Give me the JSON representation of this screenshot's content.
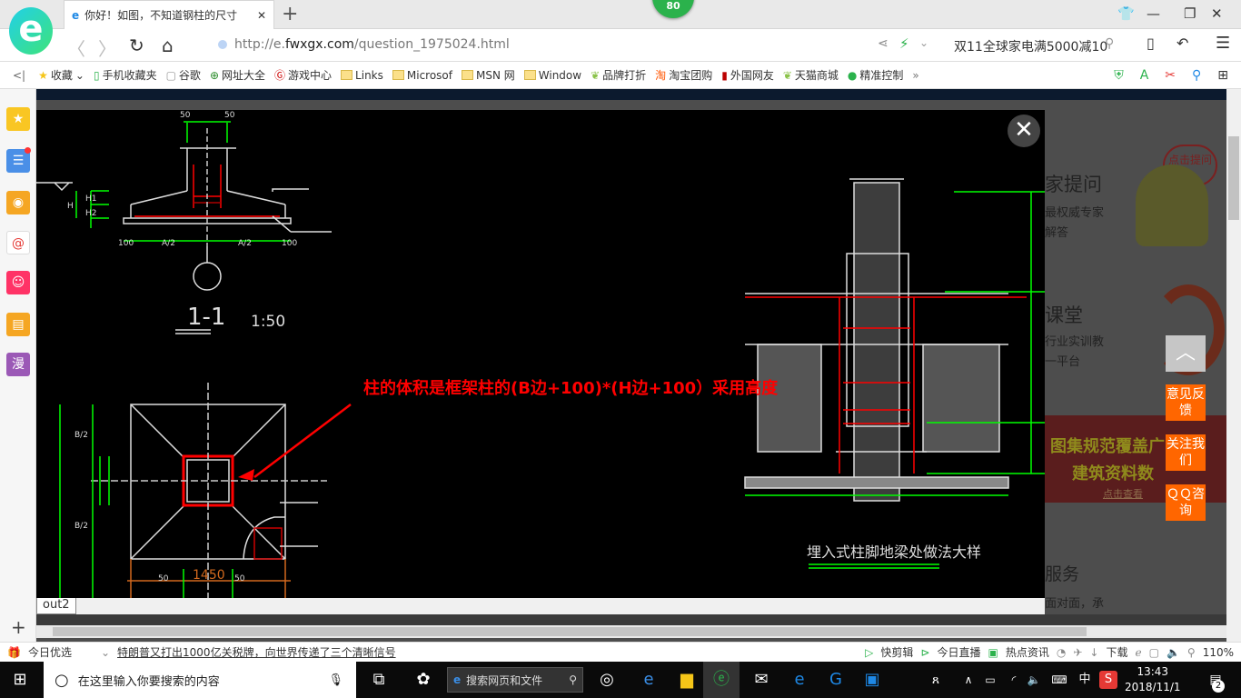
{
  "browser": {
    "tab_title": "你好！如图，不知道钢柱的尺寸",
    "badge": "80",
    "url_prefix": "http://e.",
    "url_domain": "fwxgx.com",
    "url_path": "/question_1975024.html",
    "search_text": "双11全球家电满5000减10",
    "bookmarks": [
      "收藏",
      "手机收藏夹",
      "谷歌",
      "网址大全",
      "游戏中心",
      "Links",
      "Microsof",
      "MSN 网",
      "Window",
      "品牌打折",
      "淘宝团购",
      "外国网友",
      "天猫商城",
      "精准控制"
    ],
    "more": "»"
  },
  "sidebar": {
    "items": [
      "favorites",
      "news",
      "weibo",
      "mail",
      "game",
      "notes",
      "漫"
    ]
  },
  "drawing": {
    "annotation": "柱的体积是框架柱的(B边+100)*(H边+100）采用高度",
    "section_label": "1-1",
    "scale": "1:50",
    "detail_title": "埋入式柱脚地梁处做法大样",
    "dims": {
      "d50": "50",
      "d100": "100",
      "a2": "A/2",
      "b2": "B/2",
      "d1450": "1450",
      "h": "H",
      "h1": "H1",
      "h2": "H2"
    },
    "layout_tab": "out2"
  },
  "right_panel": {
    "s1_title": "家提问",
    "s1_sub1": "最权威专家",
    "s1_sub2": "解答",
    "bubble": "点击提问",
    "s2_title": "课堂",
    "s2_sub1": "行业实训教",
    "s2_sub2": "一平台",
    "banner1": "图集规范覆盖广",
    "banner2": "建筑资料数",
    "banner_link": "点击查看",
    "s3_title": "服务",
    "s3_sub": "面对面，承"
  },
  "float_buttons": {
    "feedback": "意见反馈",
    "follow": "关注我们",
    "qq": "ＱＱ咨询"
  },
  "status": {
    "left": "今日优选",
    "news": "特朗普又打出1000亿关税牌，向世界传递了三个清晰信号",
    "items": [
      "快剪辑",
      "今日直播",
      "热点资讯",
      "下载"
    ],
    "zoom": "110%"
  },
  "taskbar": {
    "search_placeholder": "在这里输入你要搜索的内容",
    "web_search": "搜索网页和文件",
    "ime": "中",
    "time": "13:43",
    "date": "2018/11/1",
    "notifications": "2"
  }
}
